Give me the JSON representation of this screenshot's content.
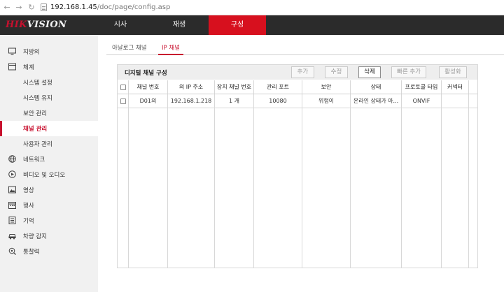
{
  "browser": {
    "url_host": "192.168.1.45",
    "url_path": "/doc/page/config.asp"
  },
  "header": {
    "logo_red": "HIK",
    "logo_white": "VISION",
    "nav": [
      {
        "label": "시사"
      },
      {
        "label": "재생"
      },
      {
        "label": "구성"
      }
    ]
  },
  "sidebar": {
    "items": [
      {
        "label": "지방의",
        "icon": "monitor-icon"
      },
      {
        "label": "체계",
        "icon": "system-icon"
      },
      {
        "label": "시스템 설정"
      },
      {
        "label": "시스템 유지"
      },
      {
        "label": "보안 관리"
      },
      {
        "label": "채널 관리"
      },
      {
        "label": "사용자 관리"
      },
      {
        "label": "네트워크",
        "icon": "globe-icon"
      },
      {
        "label": "비디오 및 오디오",
        "icon": "video-audio-icon"
      },
      {
        "label": "영상",
        "icon": "image-icon"
      },
      {
        "label": "행사",
        "icon": "calendar-icon"
      },
      {
        "label": "기억",
        "icon": "storage-icon"
      },
      {
        "label": "차량 감지",
        "icon": "vehicle-icon"
      },
      {
        "label": "통찰력",
        "icon": "insight-icon"
      }
    ]
  },
  "tabs": [
    {
      "label": "아날로그 채널"
    },
    {
      "label": "IP 채널"
    }
  ],
  "panel": {
    "title": "디지털 채널 구성",
    "buttons": {
      "add": "추가",
      "modify": "수정",
      "delete": "삭제",
      "quick_add": "빠른 추가",
      "activate": "활성화"
    },
    "columns": [
      "채널 번호",
      "의 IP 주소",
      "장치 채널 번호",
      "관리 포트",
      "보안",
      "상태",
      "프로토콜 타입",
      "커넥터"
    ],
    "rows": [
      {
        "channel": "D01의",
        "ip": "192.168.1.218",
        "device_channel": "1 개",
        "port": "10080",
        "security": "위험이",
        "status": "온라인 상태가 아...",
        "protocol": "ONVIF",
        "connector": ""
      }
    ]
  },
  "colors": {
    "accent": "#d7101e",
    "header_bg": "#2b2b2b",
    "sidebar_bg": "#f1f1f1"
  }
}
